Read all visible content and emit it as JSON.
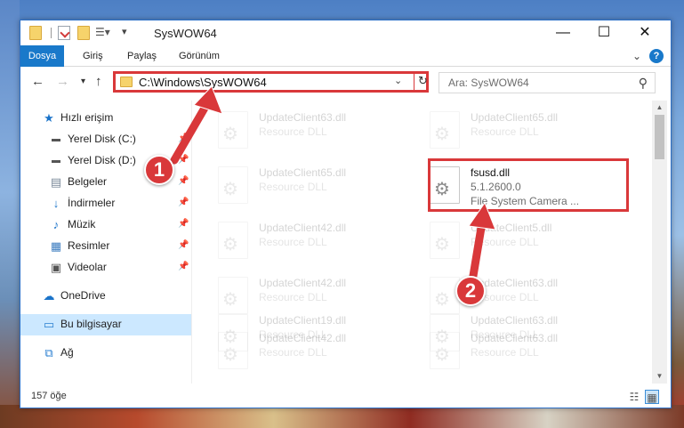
{
  "window": {
    "title": "SysWOW64",
    "controls": [
      "—",
      "☐",
      "✕"
    ]
  },
  "ribbon": {
    "tabs": [
      "Dosya",
      "Giriş",
      "Paylaş",
      "Görünüm"
    ],
    "help_label": "?"
  },
  "nav": {
    "address": "C:\\Windows\\SysWOW64",
    "search_placeholder": "Ara: SysWOW64"
  },
  "sidebar": {
    "items": [
      {
        "label": "Hızlı erişim",
        "icon": "star-icon"
      },
      {
        "label": "Yerel Disk (C:)",
        "icon": "drive-icon",
        "pinned": true
      },
      {
        "label": "Yerel Disk (D:)",
        "icon": "drive-icon",
        "pinned": true
      },
      {
        "label": "Belgeler",
        "icon": "documents-icon",
        "pinned": true
      },
      {
        "label": "İndirmeler",
        "icon": "download-icon",
        "pinned": true
      },
      {
        "label": "Müzik",
        "icon": "music-icon",
        "pinned": true
      },
      {
        "label": "Resimler",
        "icon": "pictures-icon",
        "pinned": true
      },
      {
        "label": "Videolar",
        "icon": "videos-icon",
        "pinned": true
      },
      {
        "label": "OneDrive",
        "icon": "cloud-icon"
      },
      {
        "label": "Bu bilgisayar",
        "icon": "computer-icon",
        "selected": true
      },
      {
        "label": "Ağ",
        "icon": "network-icon"
      }
    ]
  },
  "files": [
    {
      "name": "UpdateClient63.dll",
      "type": "Resource DLL",
      "faded": true
    },
    {
      "name": "UpdateClient65.dll",
      "type": "Resource DLL",
      "faded": true
    },
    {
      "name": "UpdateClient65.dll",
      "type": "Resource DLL",
      "faded": true
    },
    {
      "name": "fsusd.dll",
      "type": "5.1.2600.0",
      "desc": "File System Camera ...",
      "faded": false,
      "highlighted": true
    },
    {
      "name": "UpdateClient42.dll",
      "type": "Resource DLL",
      "faded": true
    },
    {
      "name": "UpdateClient5.dll",
      "type": "Resource DLL",
      "faded": true
    },
    {
      "name": "UpdateClient42.dll",
      "type": "Resource DLL",
      "faded": true
    },
    {
      "name": "UpdateClient63.dll",
      "type": "Resource DLL",
      "faded": true
    },
    {
      "name": "UpdateClient42.dll",
      "type": "Resource DLL",
      "faded": true
    },
    {
      "name": "UpdateClient63.dll",
      "type": "Resource DLL",
      "faded": true
    },
    {
      "name": "UpdateClient19.dll",
      "type": "Resource DLL",
      "faded": true
    },
    {
      "name": "UpdateClient63.dll",
      "type": "Resource DLL",
      "faded": true
    }
  ],
  "status": {
    "item_count": "157 öğe"
  },
  "annotations": {
    "step1": "1",
    "step2": "2",
    "color": "#d9383a"
  }
}
